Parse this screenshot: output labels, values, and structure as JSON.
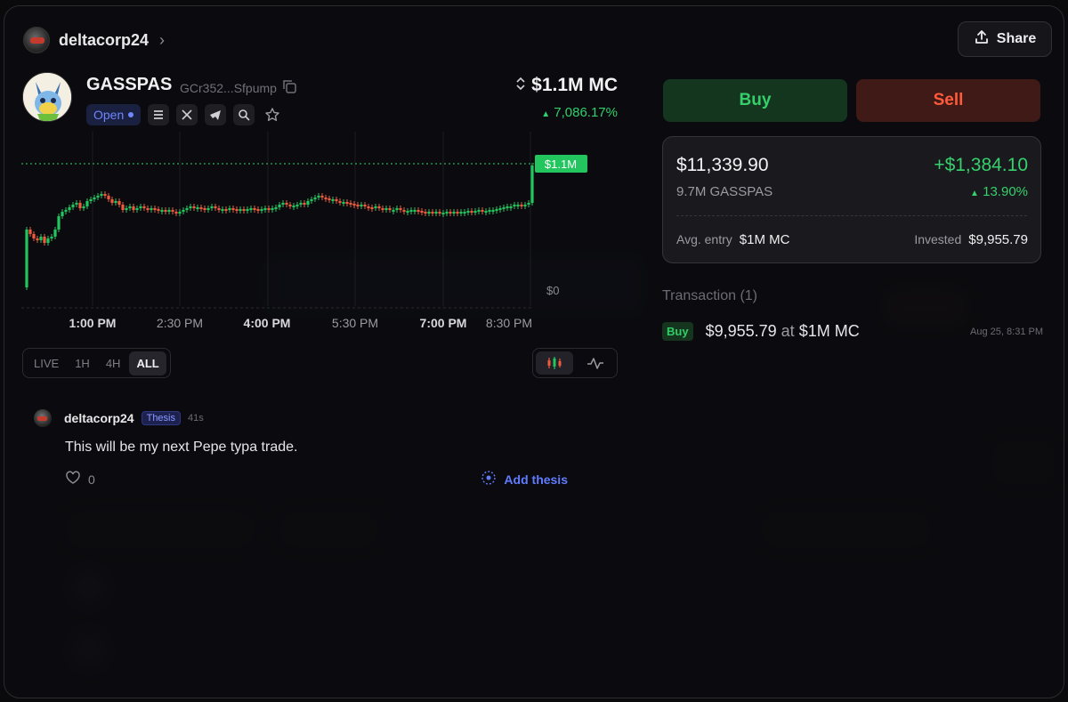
{
  "header": {
    "username": "deltacorp24",
    "share_label": "Share"
  },
  "token": {
    "name": "GASSPAS",
    "address": "GCr352...Sfpump",
    "status": "Open",
    "market_cap": "$1.1M MC",
    "change": "7,086.17%"
  },
  "chart": {
    "price_tag": "$1.1M",
    "zero_label": "$0",
    "time_labels": [
      "1:00 PM",
      "2:30 PM",
      "4:00 PM",
      "5:30 PM",
      "7:00 PM",
      "8:30 PM"
    ],
    "time_labels_bold": [
      true,
      false,
      true,
      false,
      true,
      false
    ],
    "up_color": "#22c55e",
    "down_color": "#ef5a3c"
  },
  "ranges": {
    "items": [
      "LIVE",
      "1H",
      "4H",
      "ALL"
    ],
    "active": "ALL"
  },
  "comment": {
    "username": "deltacorp24",
    "tag": "Thesis",
    "time": "41s",
    "text": "This will be my next Pepe typa trade.",
    "likes": "0",
    "add_thesis": "Add thesis"
  },
  "trade": {
    "buy_label": "Buy",
    "sell_label": "Sell"
  },
  "position": {
    "value": "$11,339.90",
    "amount": "9.7M GASSPAS",
    "pnl": "+$1,384.10",
    "pnl_pct": "13.90%",
    "avg_entry_label": "Avg. entry",
    "avg_entry": "$1M MC",
    "invested_label": "Invested",
    "invested": "$9,955.79"
  },
  "transactions": {
    "title": "Transaction (1)",
    "items": [
      {
        "type": "Buy",
        "amount": "$9,955.79",
        "at": "at",
        "mc": "$1M MC",
        "time": "Aug 25, 8:31 PM"
      }
    ]
  }
}
